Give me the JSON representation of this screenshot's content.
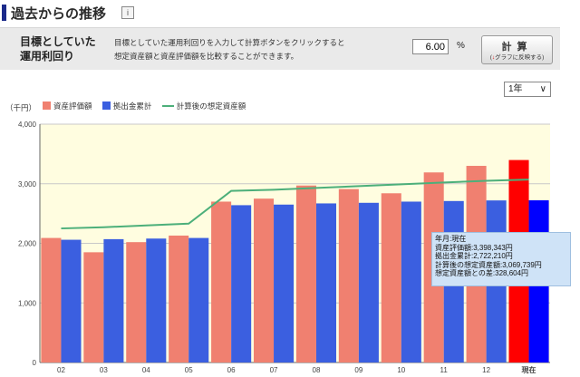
{
  "header": {
    "title": "過去からの推移",
    "info_icon": "i"
  },
  "target": {
    "label": "目標としていた\n運用利回り",
    "description": "目標としていた運用利回りを入力して計算ボタンをクリックすると\n想定資産額と資産評価額を比較することができます。",
    "rate_value": "6.00",
    "rate_unit": "%",
    "button_label": "計算",
    "button_sub_arrow": "↓",
    "button_sub": "グラフに反映する"
  },
  "period": {
    "selected": "1年",
    "chevron": "∨"
  },
  "unit_label": "（千円）",
  "legend": [
    {
      "label": "資産評価額",
      "color": "#f08070"
    },
    {
      "label": "拠出金累計",
      "color": "#3b5fe0"
    },
    {
      "label": "計算後の想定資産額",
      "color": "#4caf7a"
    }
  ],
  "chart_data": {
    "type": "bar",
    "categories": [
      "02",
      "03",
      "04",
      "05",
      "06",
      "07",
      "08",
      "09",
      "10",
      "11",
      "12",
      "現在"
    ],
    "series": [
      {
        "name": "資産評価額",
        "values": [
          2090,
          1850,
          2020,
          2130,
          2700,
          2750,
          2970,
          2910,
          2840,
          3190,
          3300,
          3398
        ]
      },
      {
        "name": "拠出金累計",
        "values": [
          2060,
          2070,
          2080,
          2090,
          2640,
          2650,
          2670,
          2680,
          2700,
          2710,
          2720,
          2722
        ]
      },
      {
        "name": "計算後の想定資産額",
        "type": "line",
        "values": [
          2250,
          2270,
          2300,
          2330,
          2880,
          2900,
          2930,
          2960,
          2990,
          3020,
          3050,
          3070
        ]
      }
    ],
    "ylim": [
      0,
      4000
    ],
    "yticks": [
      "0",
      "1,000",
      "2,000",
      "3,000",
      "4,000"
    ],
    "highlight_index": 11,
    "highlight_colors": {
      "asset": "#ff0000",
      "contribution": "#0000ff"
    },
    "grid": true,
    "plot_background": "#fffde0"
  },
  "tooltip": {
    "lines": [
      "年月:現在",
      "資産評価額:3,398,343円",
      "拠出金累計:2,722,210円",
      "計算後の想定資産額:3,069,739円",
      "想定資産額との差:328,604円"
    ]
  }
}
